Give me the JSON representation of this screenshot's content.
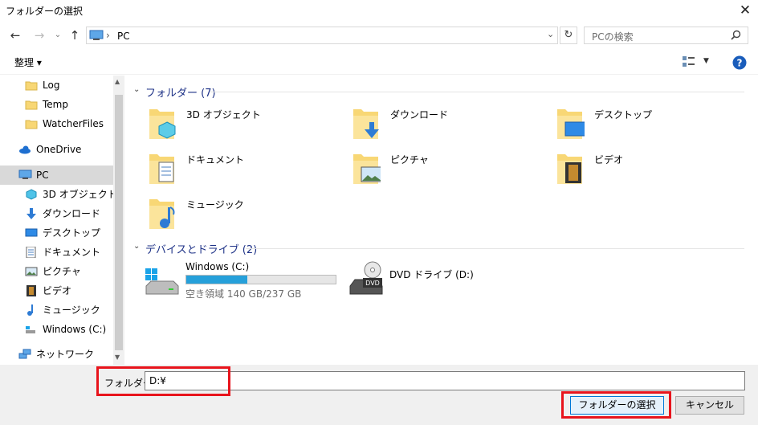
{
  "window": {
    "title": "フォルダーの選択"
  },
  "nav": {
    "breadcrumb_sep": "›",
    "location": "PC",
    "search_placeholder": "PCの検索"
  },
  "toolbar": {
    "organize_label": "整理 ▾"
  },
  "sidebar": {
    "items": [
      {
        "label": "Log",
        "icon": "folder-icon"
      },
      {
        "label": "Temp",
        "icon": "folder-icon"
      },
      {
        "label": "WatcherFiles",
        "icon": "folder-icon"
      },
      {
        "label": "OneDrive",
        "icon": "cloud-icon"
      },
      {
        "label": "PC",
        "icon": "pc-icon",
        "selected": true
      },
      {
        "label": "3D オブジェクト",
        "icon": "cube-icon"
      },
      {
        "label": "ダウンロード",
        "icon": "download-icon"
      },
      {
        "label": "デスクトップ",
        "icon": "desktop-icon"
      },
      {
        "label": "ドキュメント",
        "icon": "document-icon"
      },
      {
        "label": "ピクチャ",
        "icon": "picture-icon"
      },
      {
        "label": "ビデオ",
        "icon": "video-icon"
      },
      {
        "label": "ミュージック",
        "icon": "music-icon"
      },
      {
        "label": "Windows (C:)",
        "icon": "drive-icon"
      },
      {
        "label": "ネットワーク",
        "icon": "network-icon"
      }
    ]
  },
  "main": {
    "folders_group": "フォルダー (7)",
    "folders": [
      {
        "label": "3D オブジェクト"
      },
      {
        "label": "ダウンロード"
      },
      {
        "label": "デスクトップ"
      },
      {
        "label": "ドキュメント"
      },
      {
        "label": "ピクチャ"
      },
      {
        "label": "ビデオ"
      },
      {
        "label": "ミュージック"
      }
    ],
    "drives_group": "デバイスとドライブ (2)",
    "drives": [
      {
        "label": "Windows (C:)",
        "free_text": "空き領域 140 GB/237 GB",
        "used_fraction": 0.41
      },
      {
        "label": "DVD ドライブ (D:)"
      }
    ]
  },
  "bottom": {
    "folder_label": "フォルダー:",
    "folder_value": "D:¥",
    "select_button": "フォルダーの選択",
    "cancel_button": "キャンセル"
  },
  "colors": {
    "accent": "#0078d7",
    "highlight": "#e8141c",
    "folder": "#f8d775",
    "progress": "#26a0da"
  }
}
